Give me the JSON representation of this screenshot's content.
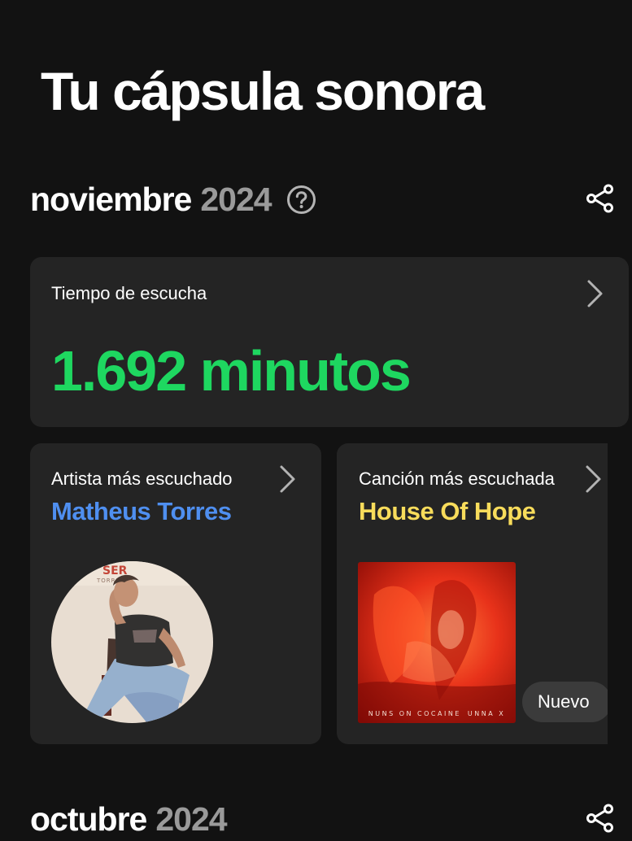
{
  "page": {
    "title": "Tu cápsula sonora"
  },
  "month_section": {
    "month": "noviembre",
    "year": "2024",
    "help_icon": "question-circle-icon",
    "share_icon": "share-icon"
  },
  "listening_time": {
    "label": "Tiempo de escucha",
    "value": "1.692 minutos",
    "accent_color": "#1ed760"
  },
  "top_artist": {
    "label": "Artista más escuchado",
    "name": "Matheus Torres",
    "color": "#4f8ff0",
    "photo_text": "SER",
    "photo_subtext": "TORRES"
  },
  "top_song": {
    "label": "Canción más escuchada",
    "name": "House Of Hope",
    "color": "#f8dc5b",
    "cover_caption_left": "NUNS ON COCAINE",
    "cover_caption_right": "UNNA X",
    "badge": "Nuevo"
  },
  "next_month_section": {
    "month": "octubre",
    "year": "2024"
  },
  "colors": {
    "background": "#121212",
    "card": "#242424",
    "muted_year": "#9a9a9a"
  }
}
